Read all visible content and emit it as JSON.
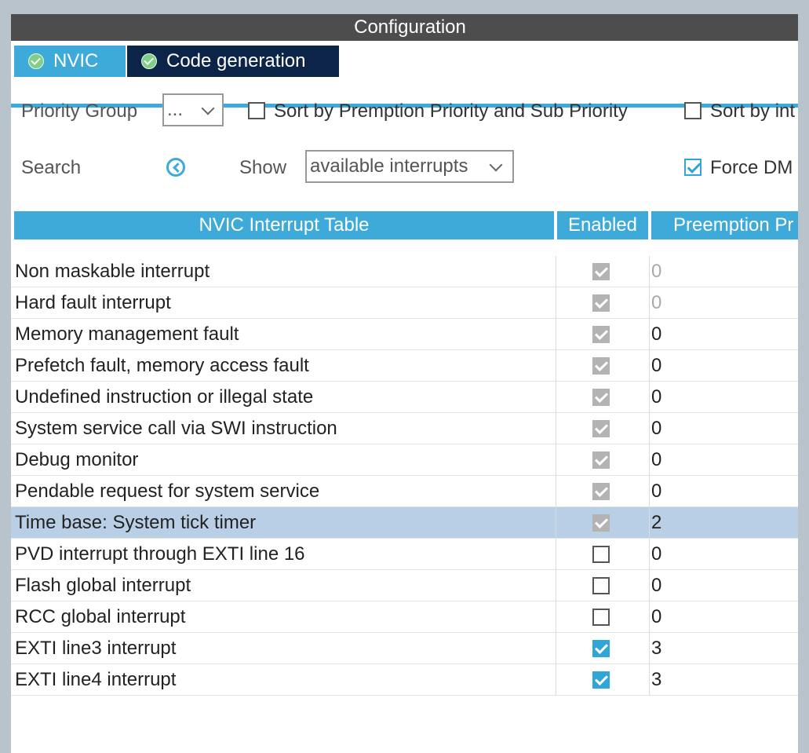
{
  "window": {
    "title": "Configuration"
  },
  "tabs": [
    {
      "label": "NVIC",
      "active": true
    },
    {
      "label": "Code generation",
      "active": false
    }
  ],
  "controls": {
    "priority_group_label": "Priority Group",
    "priority_group_value": "...",
    "sort_premption_label": "Sort by Premption Priority and Sub Priority",
    "sort_premption_checked": false,
    "sort_int_label": "Sort by int",
    "sort_int_checked": false,
    "search_label": "Search",
    "show_label": "Show",
    "show_value": "available interrupts",
    "force_dma_label": "Force DM",
    "force_dma_checked": true
  },
  "table": {
    "headers": [
      "NVIC Interrupt Table",
      "Enabled",
      "Preemption Pr"
    ],
    "rows": [
      {
        "name": "Non maskable interrupt",
        "enabled": "locked",
        "priority": "0",
        "priority_dim": true,
        "selected": false
      },
      {
        "name": "Hard fault interrupt",
        "enabled": "locked",
        "priority": "0",
        "priority_dim": true,
        "selected": false
      },
      {
        "name": "Memory management fault",
        "enabled": "locked",
        "priority": "0",
        "priority_dim": false,
        "selected": false
      },
      {
        "name": "Prefetch fault, memory access fault",
        "enabled": "locked",
        "priority": "0",
        "priority_dim": false,
        "selected": false
      },
      {
        "name": "Undefined instruction or illegal state",
        "enabled": "locked",
        "priority": "0",
        "priority_dim": false,
        "selected": false
      },
      {
        "name": "System service call via SWI instruction",
        "enabled": "locked",
        "priority": "0",
        "priority_dim": false,
        "selected": false
      },
      {
        "name": "Debug monitor",
        "enabled": "locked",
        "priority": "0",
        "priority_dim": false,
        "selected": false
      },
      {
        "name": "Pendable request for system service",
        "enabled": "locked",
        "priority": "0",
        "priority_dim": false,
        "selected": false
      },
      {
        "name": "Time base: System tick timer",
        "enabled": "locked",
        "priority": "2",
        "priority_dim": false,
        "selected": true
      },
      {
        "name": "PVD interrupt through EXTI line 16",
        "enabled": "off",
        "priority": "0",
        "priority_dim": false,
        "selected": false
      },
      {
        "name": "Flash global interrupt",
        "enabled": "off",
        "priority": "0",
        "priority_dim": false,
        "selected": false
      },
      {
        "name": "RCC global interrupt",
        "enabled": "off",
        "priority": "0",
        "priority_dim": false,
        "selected": false
      },
      {
        "name": "EXTI line3 interrupt",
        "enabled": "on",
        "priority": "3",
        "priority_dim": false,
        "selected": false
      },
      {
        "name": "EXTI line4 interrupt",
        "enabled": "on",
        "priority": "3",
        "priority_dim": false,
        "selected": false
      }
    ]
  },
  "colors": {
    "accent": "#3eaad9",
    "tab_dark": "#0b2448",
    "titlebar": "#4d4d4d",
    "selected_row": "#b8cfe6"
  }
}
